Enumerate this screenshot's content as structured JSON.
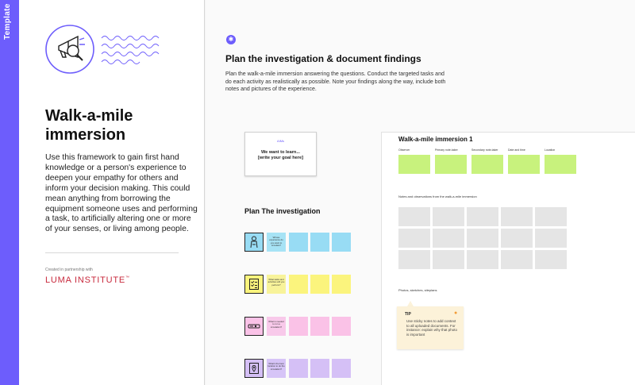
{
  "sidebar_strip": {
    "label": "Template"
  },
  "left": {
    "title": "Walk-a-mile immersion",
    "description": "Use this framework to gain first hand knowledge or a person's experience to deepen your empathy for others and inform your decision making. This could mean anything from borrowing the equipment someone uses and performing a task, to artificially altering one or more of your senses, or living among people.",
    "partner_text": "Created in partnership with",
    "partner_logo": "LUMA INSTITUTE",
    "partner_tm": "™"
  },
  "board": {
    "badge_icon": "✱",
    "heading": "Plan the investigation & document findings",
    "intro": "Plan the walk-a-mile immersion answering the questions. Conduct the targeted tasks and do each activity as realistically as possible. Note your findings along the way, include both notes and pictures of the experience.",
    "goal_card": {
      "aims_label": "AIMs",
      "line1": "We want to learn...",
      "line2": "[write your goal here]"
    },
    "plan_title": "Plan The investigation",
    "plan_rows": [
      {
        "icon": "person-icon",
        "question": "Whose experience do you want to simulate?",
        "question_color": "#a7e3f5",
        "sticky_color": "#98dcf4"
      },
      {
        "icon": "checklist-icon",
        "question": "What tasks and activities will you perform?",
        "question_color": "#f8f39a",
        "sticky_color": "#fbf47d"
      },
      {
        "icon": "tools-icon",
        "question": "What is needed to run a simulation?",
        "question_color": "#f8c9ea",
        "sticky_color": "#fac2e7"
      },
      {
        "icon": "location-icon",
        "question": "What's the best location to do the simulation?",
        "question_color": "#d6c4f7",
        "sticky_color": "#d5c0f6"
      }
    ],
    "canvas": {
      "title": "Walk-a-mile immersion 1",
      "columns": [
        "Observer",
        "Primary note-taker",
        "Secondary note-taker",
        "Date and time",
        "Location"
      ],
      "notes_label": "Notes and observations from the walk-a-mile immersion",
      "photos_label": "Photos, sketches, siteplans",
      "tip": {
        "title": "TIP",
        "text": "Use sticky notes to add context to all uploaded documents. For instance: explain why that photo is important"
      }
    }
  },
  "colors": {
    "accent": "#6d5dfc",
    "green_sticky": "#c8f27d",
    "gray_sticky": "#e5e5e5",
    "tip_bg": "#fcf2d9",
    "luma_red": "#c8293c"
  }
}
